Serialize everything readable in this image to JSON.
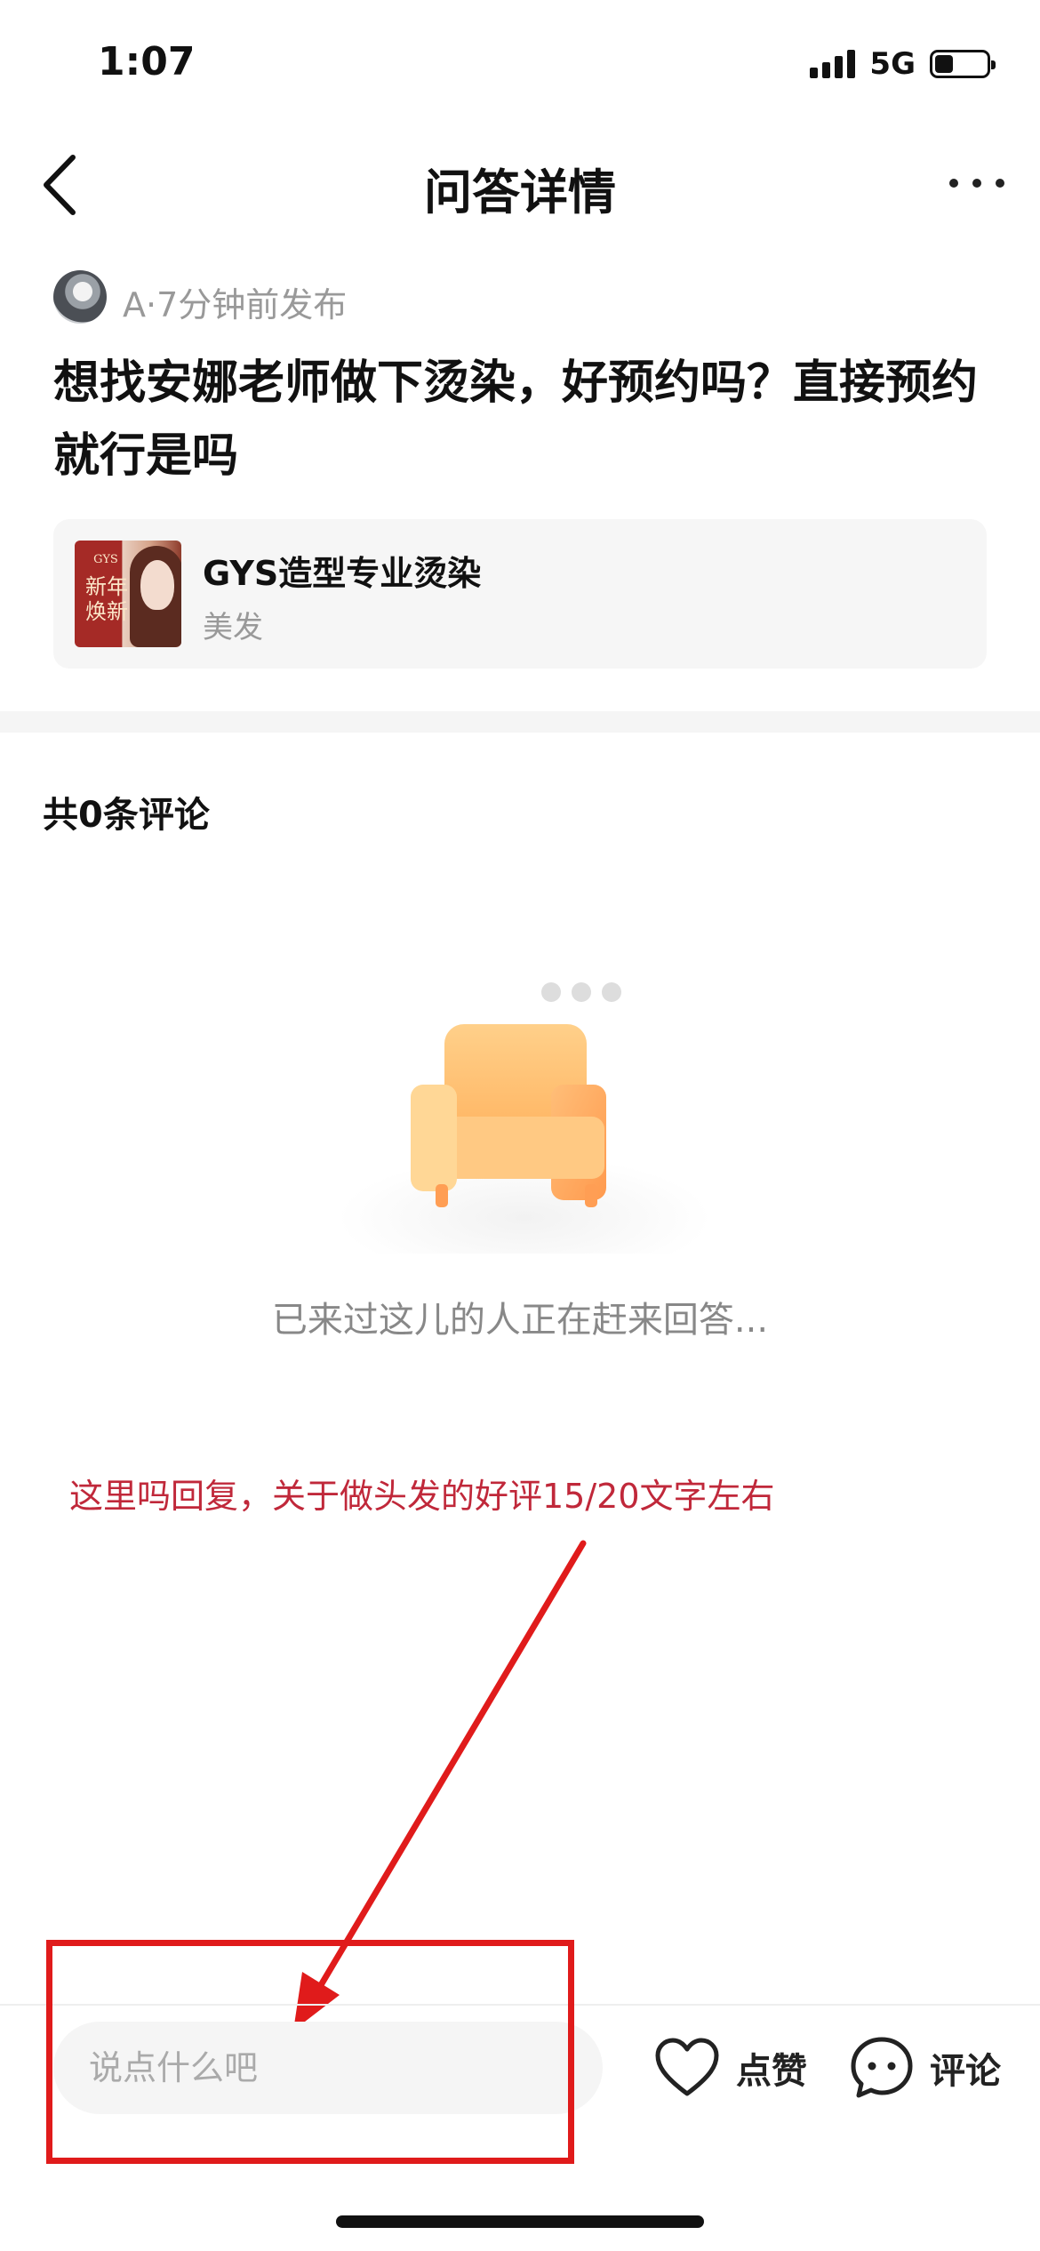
{
  "status_bar": {
    "time": "1:07",
    "network": "5G",
    "battery_level": 0.35
  },
  "nav": {
    "title": "问答详情",
    "back_icon": "chevron-left-icon",
    "more_icon": "more-horizontal-icon"
  },
  "question": {
    "meta": "A·7分钟前发布",
    "text": "想找安娜老师做下烫染，好预约吗？直接预约就行是吗"
  },
  "shop_card": {
    "name": "GYS造型专业烫染",
    "category": "美发",
    "thumb_brand": "GYS",
    "thumb_tag": "新年焕新"
  },
  "comments": {
    "count_label": "共0条评论",
    "empty_text": "已来过这儿的人正在赶来回答..."
  },
  "annotation": {
    "text": "这里吗回复，关于做头发的好评15/20文字左右",
    "color": "#c0283a",
    "arrow_color": "#e01b1b"
  },
  "bottom_bar": {
    "input_placeholder": "说点什么吧",
    "like_label": "点赞",
    "comment_label": "评论"
  }
}
